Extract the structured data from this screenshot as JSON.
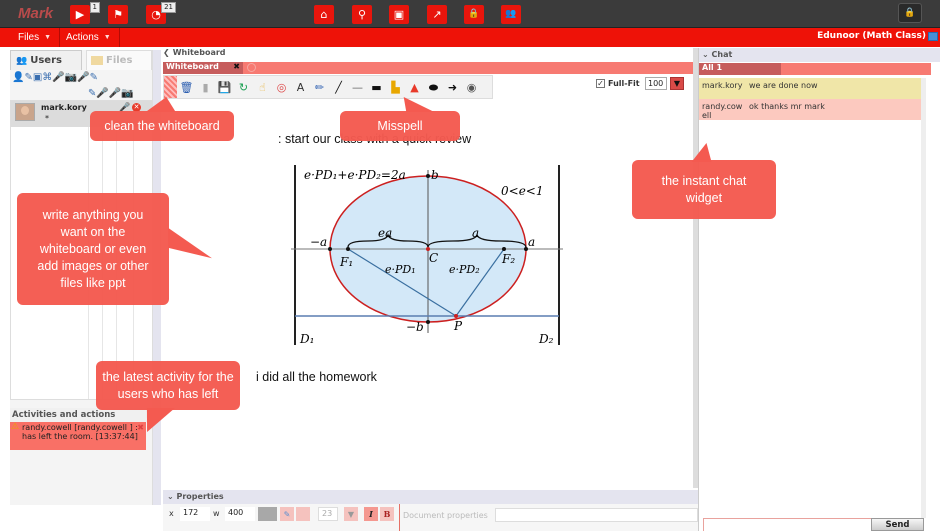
{
  "topbar": {
    "brand": "Mark",
    "buttons": [
      {
        "name": "play-icon",
        "glyph": "▶",
        "badge": "1"
      },
      {
        "name": "flag-icon",
        "glyph": "⚑",
        "badge": ""
      },
      {
        "name": "pie-icon",
        "glyph": "◔",
        "badge": "21"
      },
      {
        "name": "home-icon",
        "glyph": "⌂"
      },
      {
        "name": "search-icon",
        "glyph": "⚲"
      },
      {
        "name": "contact-book-icon",
        "glyph": "▣"
      },
      {
        "name": "share-icon",
        "glyph": "↗"
      },
      {
        "name": "lock-icon",
        "glyph": "🔒"
      },
      {
        "name": "group-icon",
        "glyph": "👥"
      }
    ],
    "lock_glyph": "🔒"
  },
  "menubar": {
    "files": "Files",
    "actions": "Actions",
    "caret": "▼",
    "class_name": "Edunoor (Math Class)"
  },
  "left": {
    "tab_users": "Users",
    "tab_files": "Files",
    "users_icon": "👥",
    "toolbar_icons": "👤✎▣⌘🎤📷🎤✎",
    "col_icons": "✎🎤🎤📷",
    "users": [
      {
        "name": "mark.kory",
        "status": "*"
      }
    ],
    "activities_title": "Activities and actions",
    "activity": {
      "icon": "⚠",
      "text": "randy.cowell [randy.cowell  ] : has left the room. [13:37:44]",
      "close": "✖"
    }
  },
  "whiteboard": {
    "header": "Whiteboard",
    "collapse_glyph": "❮",
    "tab_label": "Whiteboard",
    "tab_close": "✖",
    "tools": [
      {
        "name": "trash-icon",
        "glyph": "🗑",
        "color": "#2a5db0"
      },
      {
        "name": "delete-page-icon",
        "glyph": "▮",
        "color": "#aaa"
      },
      {
        "name": "save-icon",
        "glyph": "💾",
        "color": "#2a5db0"
      },
      {
        "name": "undo-icon",
        "glyph": "↻",
        "color": "#1aa052"
      },
      {
        "name": "pointer-icon",
        "glyph": "☝",
        "color": "#e8b84a"
      },
      {
        "name": "target-icon",
        "glyph": "◎",
        "color": "#d44"
      },
      {
        "name": "text-icon",
        "glyph": "A",
        "color": "#333"
      },
      {
        "name": "pencil-icon",
        "glyph": "✏",
        "color": "#2a5db0"
      },
      {
        "name": "line-icon",
        "glyph": "╱",
        "color": "#111"
      },
      {
        "name": "underline-icon",
        "glyph": "—",
        "color": "#666"
      },
      {
        "name": "rectangle-icon",
        "glyph": "▬",
        "color": "#111"
      },
      {
        "name": "highlighter-icon",
        "glyph": "▙",
        "color": "#e8a700"
      },
      {
        "name": "spellcheck-icon",
        "glyph": "▲",
        "color": "#e83a2a"
      },
      {
        "name": "ellipse-icon",
        "glyph": "⬬",
        "color": "#111"
      },
      {
        "name": "arrow-icon",
        "glyph": "➜",
        "color": "#111"
      },
      {
        "name": "clipart-icon",
        "glyph": "◉",
        "color": "#555"
      }
    ],
    "full_fit_label": "Full-Fit",
    "full_fit_checked": true,
    "zoom_value": "100",
    "text_line1": ": start our class with a quick review",
    "text_line2": "i did all the homework"
  },
  "figure": {
    "formula": "e·PD₁+e·PD₂=2a",
    "condition": "0<e<1",
    "labels": {
      "b": "b",
      "neg_b": "−b",
      "a": "a",
      "neg_a": "−a",
      "ea": "ea",
      "a_top": "a",
      "F1": "F₁",
      "F2": "F₂",
      "C": "C",
      "P": "P",
      "ePD1": "e·PD₁",
      "ePD2": "e·PD₂",
      "D1": "D₁",
      "D2": "D₂"
    }
  },
  "properties": {
    "header": "Properties",
    "x_label": "x",
    "x_value": "172",
    "w_label": "w",
    "w_value": "400",
    "font_size": "23",
    "italic": "I",
    "bold": "B",
    "doc_props_label": "Document properties",
    "doc_props_value": ""
  },
  "chat": {
    "header": "Chat",
    "tab_label": "All 1",
    "messages": [
      {
        "from": "mark.kory",
        "text": "we are done now",
        "bg": "#f0e6a8"
      },
      {
        "from": "randy.cowell",
        "text": "ok thanks mr mark",
        "bg": "#fcc9bf"
      }
    ],
    "input_value": "",
    "send_label": "Send"
  },
  "callouts": {
    "clean": "clean the whiteboard",
    "misspell": "Misspell",
    "write": "write anything you want on the whiteboard or even add images or other files like ppt",
    "chat": "the instant chat widget",
    "activity": "the latest activity for the users who has left"
  },
  "colors": {
    "accent": "#ee1208",
    "callout": "#f45a50",
    "tab": "#f77a72",
    "tab_active": "#c65c5c"
  }
}
